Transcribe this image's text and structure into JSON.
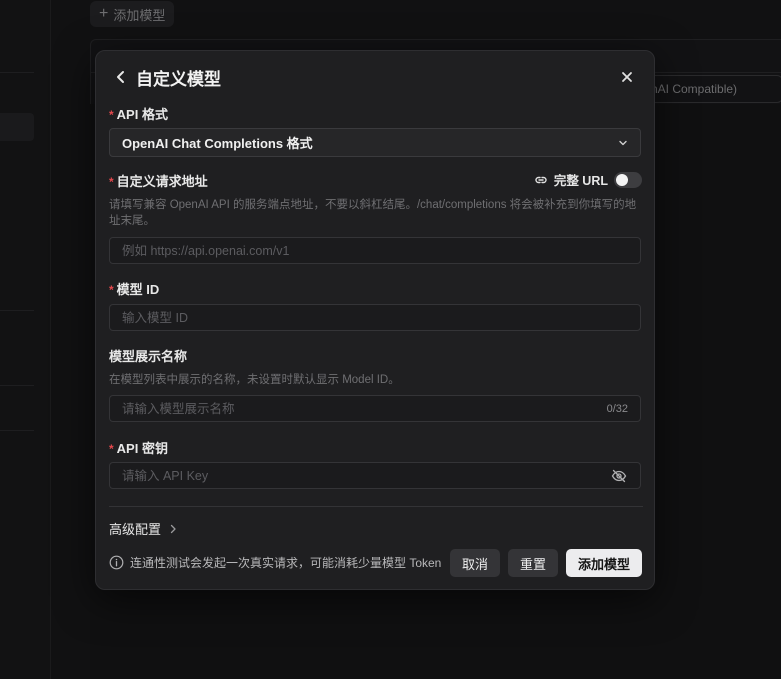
{
  "background": {
    "add_model_label": "添加模型",
    "type_chip_text": "nAI Compatible)"
  },
  "dialog": {
    "title": "自定义模型",
    "api_format": {
      "label": "API 格式",
      "value": "OpenAI Chat Completions 格式"
    },
    "endpoint": {
      "label": "自定义请求地址",
      "full_url_label": "完整 URL",
      "full_url_enabled": false,
      "help": "请填写兼容 OpenAI API 的服务端点地址，不要以斜杠结尾。/chat/completions 将会被补充到你填写的地址末尾。",
      "placeholder": "例如 https://api.openai.com/v1",
      "value": ""
    },
    "model_id": {
      "label": "模型 ID",
      "placeholder": "输入模型 ID",
      "value": ""
    },
    "display_name": {
      "label": "模型展示名称",
      "help": "在模型列表中展示的名称，未设置时默认显示 Model ID。",
      "placeholder": "请输入模型展示名称",
      "value": "",
      "counter": "0/32"
    },
    "api_key": {
      "label": "API 密钥",
      "placeholder": "请输入 API Key",
      "value": ""
    },
    "advanced_label": "高级配置",
    "footer_note": "连通性测试会发起一次真实请求，可能消耗少量模型 Token",
    "buttons": {
      "cancel": "取消",
      "reset": "重置",
      "submit": "添加模型"
    }
  },
  "colors": {
    "required_mark": "#e5484d",
    "dialog_bg": "#1f1f21",
    "primary_button": "#ececee"
  }
}
